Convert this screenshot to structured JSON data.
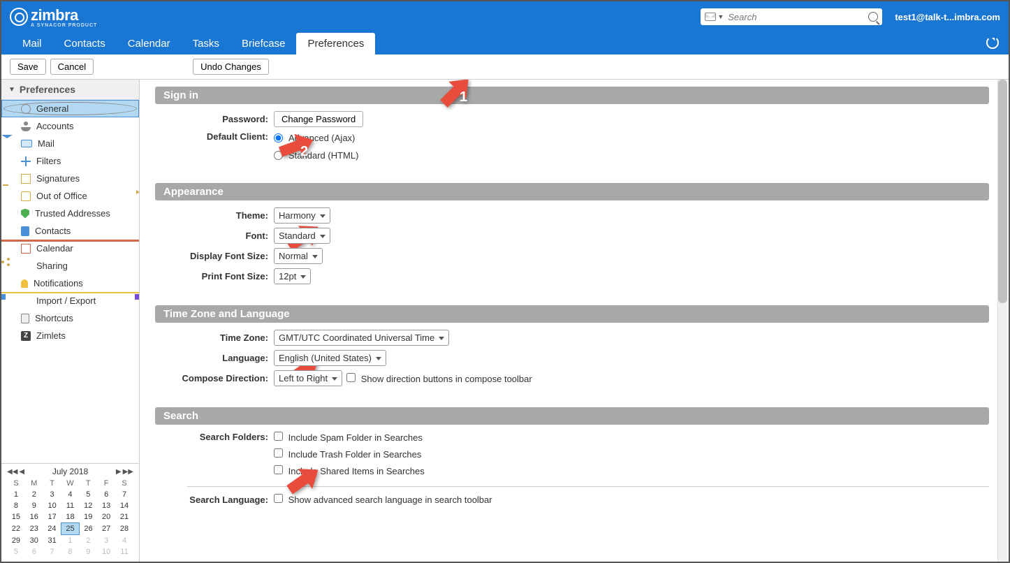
{
  "header": {
    "logo_text": "zimbra",
    "logo_sub": "A SYNACOR PRODUCT",
    "search_placeholder": "Search",
    "user": "test1@talk-t...imbra.com"
  },
  "tabs": [
    "Mail",
    "Contacts",
    "Calendar",
    "Tasks",
    "Briefcase",
    "Preferences"
  ],
  "active_tab": "Preferences",
  "toolbar": {
    "save": "Save",
    "cancel": "Cancel",
    "undo": "Undo Changes"
  },
  "sidebar": {
    "title": "Preferences",
    "items": [
      {
        "label": "General",
        "icon": "gear",
        "active": true
      },
      {
        "label": "Accounts",
        "icon": "user"
      },
      {
        "label": "Mail",
        "icon": "mail"
      },
      {
        "label": "Filters",
        "icon": "filter"
      },
      {
        "label": "Signatures",
        "icon": "sig"
      },
      {
        "label": "Out of Office",
        "icon": "out"
      },
      {
        "label": "Trusted Addresses",
        "icon": "shield"
      },
      {
        "label": "Contacts",
        "icon": "contacts"
      },
      {
        "label": "Calendar",
        "icon": "cal"
      },
      {
        "label": "Sharing",
        "icon": "share"
      },
      {
        "label": "Notifications",
        "icon": "bell"
      },
      {
        "label": "Import / Export",
        "icon": "import"
      },
      {
        "label": "Shortcuts",
        "icon": "short"
      },
      {
        "label": "Zimlets",
        "icon": "z"
      }
    ]
  },
  "calendar": {
    "title": "July 2018",
    "dow": [
      "S",
      "M",
      "T",
      "W",
      "T",
      "F",
      "S"
    ],
    "weeks": [
      [
        {
          "d": 1
        },
        {
          "d": 2
        },
        {
          "d": 3
        },
        {
          "d": 4
        },
        {
          "d": 5
        },
        {
          "d": 6
        },
        {
          "d": 7
        }
      ],
      [
        {
          "d": 8
        },
        {
          "d": 9
        },
        {
          "d": 10
        },
        {
          "d": 11
        },
        {
          "d": 12
        },
        {
          "d": 13
        },
        {
          "d": 14
        }
      ],
      [
        {
          "d": 15
        },
        {
          "d": 16
        },
        {
          "d": 17
        },
        {
          "d": 18
        },
        {
          "d": 19
        },
        {
          "d": 20
        },
        {
          "d": 21
        }
      ],
      [
        {
          "d": 22
        },
        {
          "d": 23
        },
        {
          "d": 24
        },
        {
          "d": 25,
          "today": true
        },
        {
          "d": 26
        },
        {
          "d": 27
        },
        {
          "d": 28
        }
      ],
      [
        {
          "d": 29
        },
        {
          "d": 30
        },
        {
          "d": 31
        },
        {
          "d": 1,
          "dim": true
        },
        {
          "d": 2,
          "dim": true
        },
        {
          "d": 3,
          "dim": true
        },
        {
          "d": 4,
          "dim": true
        }
      ],
      [
        {
          "d": 5,
          "dim": true
        },
        {
          "d": 6,
          "dim": true
        },
        {
          "d": 7,
          "dim": true
        },
        {
          "d": 8,
          "dim": true
        },
        {
          "d": 9,
          "dim": true
        },
        {
          "d": 10,
          "dim": true
        },
        {
          "d": 11,
          "dim": true
        }
      ]
    ]
  },
  "sections": {
    "signin": {
      "title": "Sign in",
      "password_label": "Password:",
      "password_btn": "Change Password",
      "client_label": "Default Client:",
      "client_opts": [
        "Advanced (Ajax)",
        "Standard (HTML)"
      ],
      "client_selected": 0
    },
    "appearance": {
      "title": "Appearance",
      "theme_label": "Theme:",
      "theme_value": "Harmony",
      "font_label": "Font:",
      "font_value": "Standard",
      "dfs_label": "Display Font Size:",
      "dfs_value": "Normal",
      "pfs_label": "Print Font Size:",
      "pfs_value": "12pt"
    },
    "tz": {
      "title": "Time Zone and Language",
      "tz_label": "Time Zone:",
      "tz_value": "GMT/UTC Coordinated Universal Time",
      "lang_label": "Language:",
      "lang_value": "English (United States)",
      "dir_label": "Compose Direction:",
      "dir_value": "Left to Right",
      "dir_check": "Show direction buttons in compose toolbar"
    },
    "search": {
      "title": "Search",
      "folders_label": "Search Folders:",
      "opts": [
        "Include Spam Folder in Searches",
        "Include Trash Folder in Searches",
        "Include Shared Items in Searches"
      ],
      "lang_label": "Search Language:",
      "lang_opt": "Show advanced search language in search toolbar"
    }
  },
  "annotations": {
    "a1": "1",
    "a2": "2"
  }
}
